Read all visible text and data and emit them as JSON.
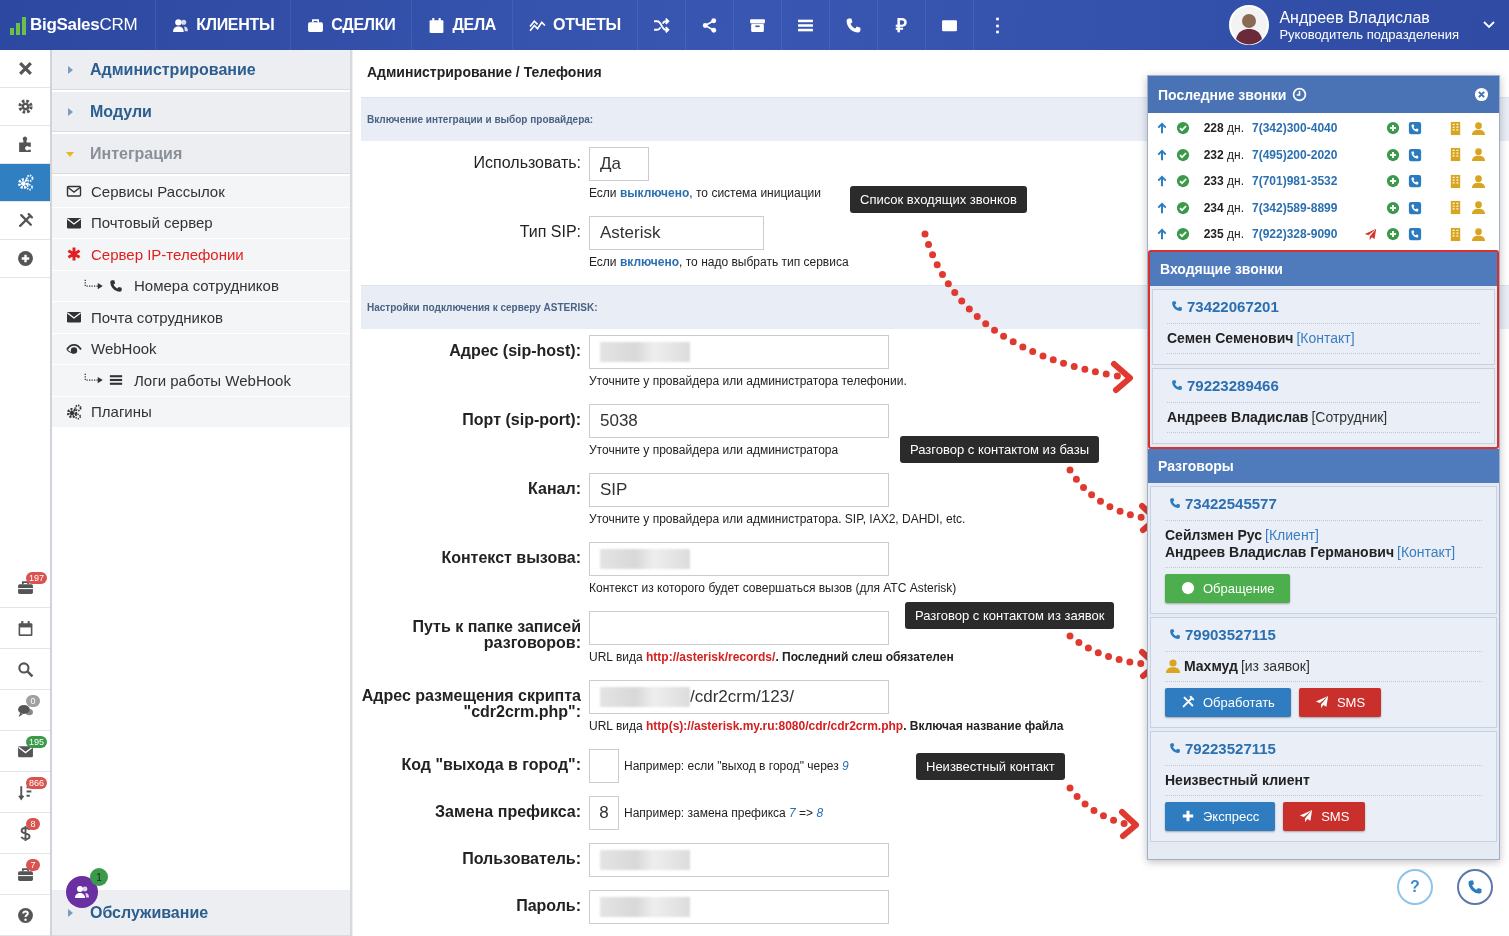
{
  "nav": {
    "logo": "**BigSales**CRM",
    "menu": [
      {
        "label": "КЛИЕНТЫ"
      },
      {
        "label": "СДЕЛКИ"
      },
      {
        "label": "ДЕЛА"
      },
      {
        "label": "ОТЧЕТЫ"
      }
    ],
    "tools": [
      {
        "kind": "icon"
      },
      {
        "kind": "icon"
      },
      {
        "kind": "icon"
      },
      {
        "kind": "icon"
      },
      {
        "kind": "icon"
      },
      {
        "kind": "glyph",
        "text": "₽"
      },
      {
        "kind": "icon"
      },
      {
        "kind": "glyph",
        "text": "⋮"
      }
    ],
    "user": {
      "name": "Андреев Владислав",
      "role": "Руководитель подразделения"
    }
  },
  "rail": {
    "top": [
      {
        "selected": false
      },
      {
        "selected": false
      },
      {
        "selected": false
      },
      {
        "selected": true
      },
      {
        "selected": false
      },
      {
        "selected": false
      }
    ],
    "bottom": [
      {
        "kind": "badge",
        "badge": "197",
        "color": "#d9534f"
      },
      {
        "kind": "plain"
      },
      {
        "kind": "plain"
      },
      {
        "kind": "badge",
        "badge": "0",
        "color": "#a0a0a0"
      },
      {
        "kind": "badge",
        "badge": "195",
        "color": "#3a9a4a"
      },
      {
        "kind": "badge",
        "badge": "866",
        "color": "#d9534f"
      },
      {
        "kind": "badge",
        "badge": "8",
        "color": "#d9534f"
      },
      {
        "kind": "badge",
        "badge": "7",
        "color": "#d9534f"
      },
      {
        "kind": "plain"
      }
    ]
  },
  "sidebar": {
    "sections": [
      {
        "label": "Администрирование",
        "expanded": false
      },
      {
        "label": "Модули",
        "expanded": false
      },
      {
        "label": "Интеграция",
        "expanded": true
      }
    ],
    "items": [
      {
        "label": "Сервисы Рассылок",
        "selected": false
      },
      {
        "label": "Почтовый сервер",
        "selected": false
      },
      {
        "label": "Сервер IP-телефонии",
        "selected": true,
        "children": [
          {
            "label": "Номера сотрудников",
            "selected": false
          }
        ]
      },
      {
        "label": "Почта сотрудников",
        "selected": false
      },
      {
        "label": "WebHook",
        "selected": false,
        "children": [
          {
            "label": "Логи работы WebHook",
            "selected": false
          }
        ]
      },
      {
        "label": "Плагины",
        "selected": false
      }
    ],
    "footer": {
      "label": "Обслуживание",
      "expanded": false,
      "badge": "1"
    }
  },
  "breadcrumb": "Администрирование / Телефония",
  "form": {
    "sections": [
      {
        "title": "Включение интеграции и выбор провайдера:",
        "bold_labels": false,
        "fields": [
          {
            "label": "Использовать:",
            "kind": "short",
            "value": "Да",
            "hint": "Если **выключено**, то система инициации"
          },
          {
            "label": "Тип SIP:",
            "kind": "medium",
            "value": "Asterisk",
            "hint": "Если **включено**, то надо выбрать тип сервиса"
          }
        ]
      },
      {
        "title": "Настройки подключения к серверу ASTERISK:",
        "bold_labels": true,
        "fields": [
          {
            "label": "Адрес (sip-host):",
            "kind": "wide",
            "blurred": true,
            "hint": "Уточните у провайдера или администратора телефонии."
          },
          {
            "label": "Порт (sip-port):",
            "kind": "wide",
            "value": "5038",
            "hint": "Уточните у провайдера или администратора"
          },
          {
            "label": "Канал:",
            "kind": "wide",
            "value": "SIP",
            "hint": "Уточните у провайдера или администратора. SIP, IAX2, DAHDI, etc."
          },
          {
            "label": "Контекст вызова:",
            "kind": "wide",
            "blurred": true,
            "hint": "Контекст из которого будет совершаться вызов (для АТС Asterisk)"
          },
          {
            "label": "Путь к папке записей разговоров:",
            "kind": "wide",
            "hint": "URL вида",
            "hint_link": "http://asterisk/records/",
            "hint_tail": ". Последний слеш обязателен"
          },
          {
            "label": "Адрес размещения скрипта \"cdr2crm.php\":",
            "kind": "wide",
            "blurred": true,
            "value": "/cdr2crm/123/",
            "hint": "URL вида",
            "hint_link": "http(s)://asterisk.my.ru:8080/cdr/cdr2crm.php",
            "hint_tail": ". Включая название файла"
          },
          {
            "label": "Код \"выхода в город\":",
            "kind": "tiny",
            "hint": "Например: если \"выход в город\" через *9*"
          },
          {
            "label": "Замена префикса:",
            "kind": "tiny",
            "value": "8",
            "hint": "Например: замена префикса *7* => *8*"
          },
          {
            "label": "Пользователь:",
            "kind": "wide",
            "blurred": true
          },
          {
            "label": "Пароль:",
            "kind": "wide",
            "blurred": true
          }
        ]
      }
    ]
  },
  "tooltips": [
    {
      "text": "Список входящих звонков"
    },
    {
      "text": "Разговор с контактом из базы"
    },
    {
      "text": "Разговор с контактом из заявок"
    },
    {
      "text": "Неизвестный контакт"
    }
  ],
  "calls_panel": {
    "title": "Последние звонки",
    "recent": [
      {
        "days": "228",
        "unit": "дн.",
        "number": "7(342)300-4040",
        "sms": false
      },
      {
        "days": "232",
        "unit": "дн.",
        "number": "7(495)200-2020",
        "sms": false
      },
      {
        "days": "233",
        "unit": "дн.",
        "number": "7(701)981-3532",
        "sms": false
      },
      {
        "days": "234",
        "unit": "дн.",
        "number": "7(342)589-8899",
        "sms": false
      },
      {
        "days": "235",
        "unit": "дн.",
        "number": "7(922)328-9090",
        "sms": true
      }
    ],
    "incoming": {
      "title": "Входящие звонки",
      "highlighted": true,
      "cards": [
        {
          "number": "73422067201",
          "people": [
            {
              "name": "Семен Семенович",
              "tag": "[Контакт]",
              "tag_link": true,
              "avatar": false
            }
          ]
        },
        {
          "number": "79223289466",
          "people": [
            {
              "name": "Андреев Владислав",
              "tag": "[Сотрудник]",
              "tag_link": false,
              "avatar": false
            }
          ]
        }
      ]
    },
    "talks": {
      "title": "Разговоры",
      "cards": [
        {
          "number": "73422545577",
          "people": [
            {
              "name": "Сейлзмен Рус",
              "tag": "[Клиент]",
              "tag_link": true,
              "avatar": false
            },
            {
              "name": "Андреев Владислав Германович",
              "tag": "[Контакт]",
              "tag_link": true,
              "avatar": false
            }
          ],
          "buttons": [
            {
              "kind": "appeal",
              "label": "Обращение"
            }
          ]
        },
        {
          "number": "79903527115",
          "people": [
            {
              "name": "Махмуд",
              "tag": "[из заявок]",
              "tag_link": false,
              "avatar": true
            }
          ],
          "buttons": [
            {
              "kind": "process",
              "label": "Обработать"
            },
            {
              "kind": "sms",
              "label": "SMS"
            }
          ]
        },
        {
          "number": "79223527115",
          "people": [
            {
              "name": "Неизвестный клиент",
              "avatar": false
            }
          ],
          "buttons": [
            {
              "kind": "express",
              "label": "Экспресс"
            },
            {
              "kind": "sms",
              "label": "SMS"
            }
          ]
        }
      ]
    }
  },
  "help": {
    "text": "?"
  }
}
